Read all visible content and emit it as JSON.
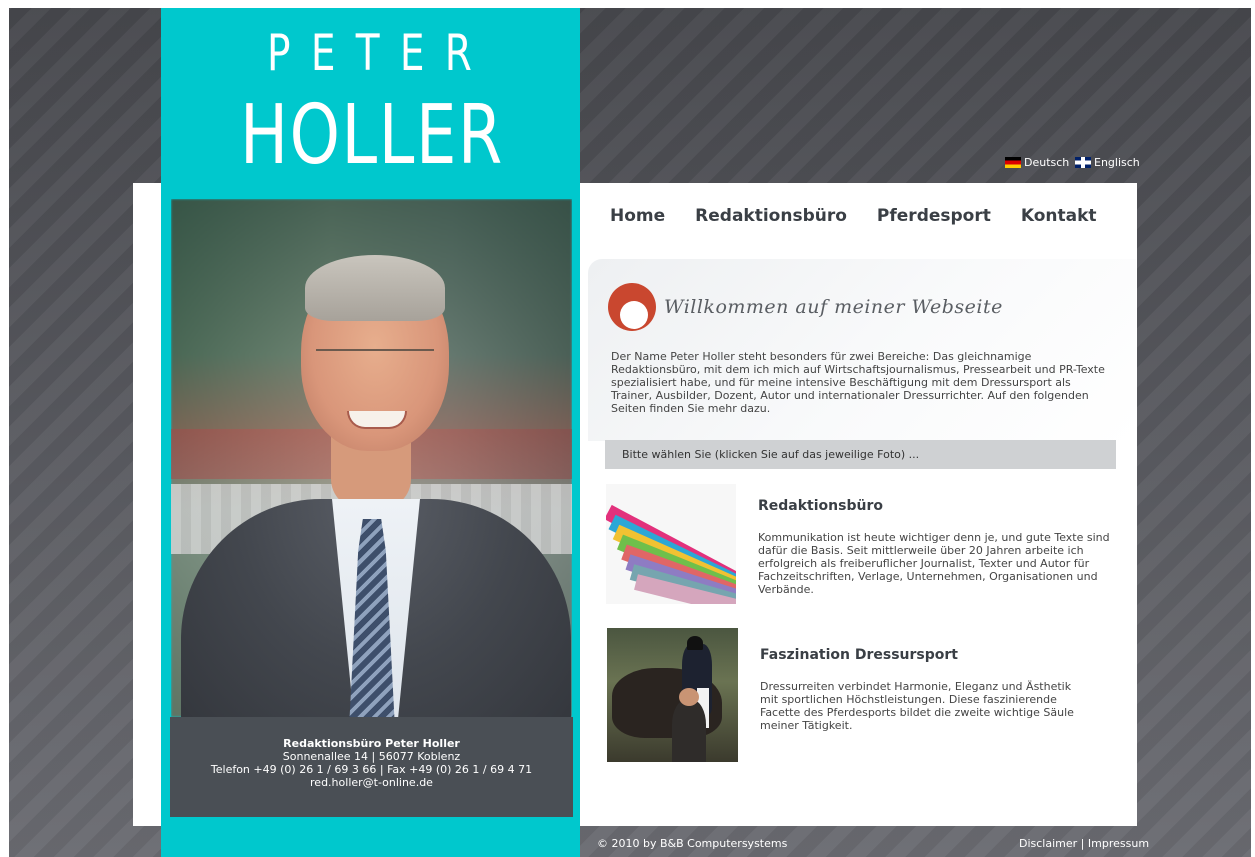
{
  "logo": {
    "line1": "PETER",
    "line2": "HOLLER"
  },
  "languages": [
    {
      "label": "Deutsch",
      "icon": "german-flag-icon"
    },
    {
      "label": "Englisch",
      "icon": "uk-flag-icon"
    }
  ],
  "nav": {
    "items": [
      "Home",
      "Redaktionsbüro",
      "Pferdesport",
      "Kontakt"
    ]
  },
  "welcome": {
    "title": "Willkommen auf meiner Webseite",
    "intro": "Der Name Peter Holler steht besonders für zwei Bereiche: Das gleichnamige Redaktionsbüro, mit dem ich mich auf Wirtschaftsjournalismus, Pressearbeit und PR-Texte spezialisiert habe, und für meine intensive Beschäftigung mit dem Dressursport als Trainer, Ausbilder, Dozent, Autor und internationaler Dressurrichter. Auf den folgenden Seiten finden Sie mehr dazu."
  },
  "select_prompt": "Bitte wählen Sie (klicken Sie auf das jeweilige Foto) ...",
  "sections": [
    {
      "title": "Redaktionsbüro",
      "text": "Kommunikation ist heute wichtiger denn je, und gute Texte sind dafür die Basis. Seit mittlerweile über 20 Jahren arbeite ich erfolgreich als freiberuflicher Journalist, Texter und Autor für Fachzeitschriften, Verlage, Unternehmen, Organisationen und Verbände."
    },
    {
      "title": "Faszination Dressursport",
      "text": "Dressurreiten verbindet Harmonie, Eleganz und Ästhetik mit sportlichen Höchstleistungen. Diese faszinierende Facette des Pferdesports bildet die zweite wichtige Säule meiner Tätigkeit."
    }
  ],
  "contact": {
    "name": "Redaktionsbüro Peter Holler",
    "address": "Sonnenallee 14 | 56077 Koblenz",
    "phone": "Telefon +49 (0) 26 1 / 69 3 66 | Fax +49 (0) 26 1 / 69 4 71",
    "email": "red.holler@t-online.de"
  },
  "footer": {
    "copyright": "© 2010 by B&B Computersystems",
    "disclaimer": "Disclaimer",
    "separator": "|",
    "impressum": "Impressum"
  }
}
